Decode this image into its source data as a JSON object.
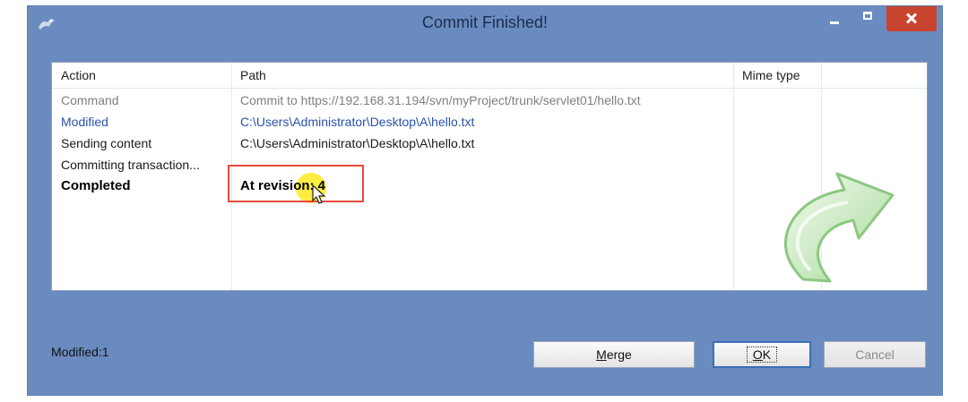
{
  "window": {
    "title": "Commit Finished!"
  },
  "columns": {
    "action": "Action",
    "path": "Path",
    "mime": "Mime type"
  },
  "rows": [
    {
      "action": "Command",
      "path": "Commit to https://192.168.31.194/svn/myProject/trunk/servlet01/hello.txt",
      "style": "gray"
    },
    {
      "action": "Modified",
      "path": "C:\\Users\\Administrator\\Desktop\\A\\hello.txt",
      "style": "blue"
    },
    {
      "action": "Sending content",
      "path": "C:\\Users\\Administrator\\Desktop\\A\\hello.txt",
      "style": "black"
    },
    {
      "action": "Committing transaction...",
      "path": "",
      "style": "black"
    },
    {
      "action": "Completed",
      "path": "At revision: 4",
      "style": "bold"
    }
  ],
  "status": "Modified:1",
  "buttons": {
    "merge_hotkey": "M",
    "merge_rest": "erge",
    "ok_hotkey": "O",
    "ok_rest": "K",
    "cancel": "Cancel"
  },
  "icons": {
    "app": "tortoisesvn-icon",
    "decoration": "green-commit-arrow-icon"
  },
  "colors": {
    "highlight_box": "#e84a3c",
    "close_button": "#c9442f",
    "window_frame": "#6a8bc0"
  }
}
